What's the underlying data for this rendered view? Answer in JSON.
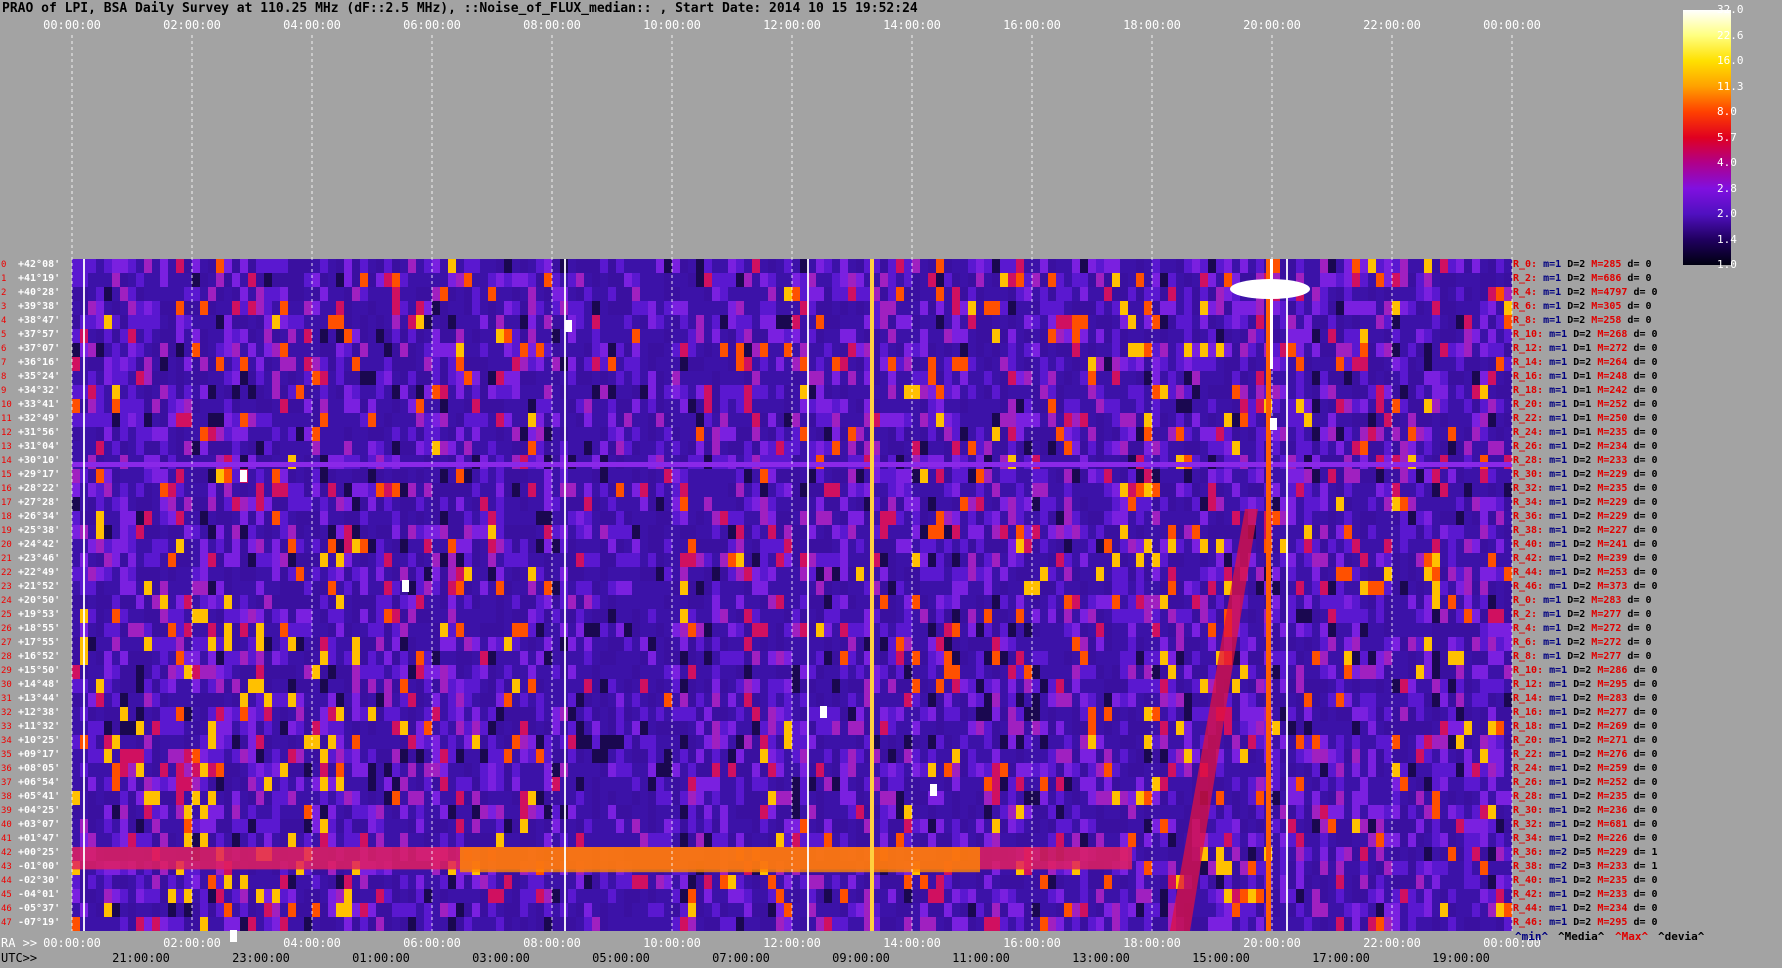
{
  "title": "PRAO of LPI, BSA Daily Survey at 110.25 MHz (dF::2.5 MHz), ::Noise_of_FLUX_median:: , Start Date: 2014 10 15 19:52:24",
  "chart_data": {
    "type": "heatmap",
    "top_ticks": [
      "00:00:00",
      "02:00:00",
      "04:00:00",
      "06:00:00",
      "08:00:00",
      "10:00:00",
      "12:00:00",
      "14:00:00",
      "16:00:00",
      "18:00:00",
      "20:00:00",
      "22:00:00",
      "00:00:00"
    ],
    "ra_axis_label": "RA >>",
    "ra_ticks": [
      "00:00:00",
      "02:00:00",
      "04:00:00",
      "06:00:00",
      "08:00:00",
      "10:00:00",
      "12:00:00",
      "14:00:00",
      "16:00:00",
      "18:00:00",
      "20:00:00",
      "22:00:00",
      "00:00:00"
    ],
    "utc_axis_label": "UTC>>",
    "utc_ticks": [
      "21:00:00",
      "23:00:00",
      "01:00:00",
      "03:00:00",
      "05:00:00",
      "07:00:00",
      "09:00:00",
      "11:00:00",
      "13:00:00",
      "15:00:00",
      "17:00:00",
      "19:00:00"
    ],
    "declinations": [
      "+42°08'",
      "+41°19'",
      "+40°28'",
      "+39°38'",
      "+38°47'",
      "+37°57'",
      "+37°07'",
      "+36°16'",
      "+35°24'",
      "+34°32'",
      "+33°41'",
      "+32°49'",
      "+31°56'",
      "+31°04'",
      "+30°10'",
      "+29°17'",
      "+28°22'",
      "+27°28'",
      "+26°34'",
      "+25°38'",
      "+24°42'",
      "+23°46'",
      "+22°49'",
      "+21°52'",
      "+20°50'",
      "+19°53'",
      "+18°55'",
      "+17°55'",
      "+16°52'",
      "+15°50'",
      "+14°48'",
      "+13°44'",
      "+12°38'",
      "+11°32'",
      "+10°25'",
      "+09°17'",
      "+08°05'",
      "+06°54'",
      "+05°41'",
      "+04°25'",
      "+03°07'",
      "+01°47'",
      "+00°25'",
      "-01°00'",
      "-02°30'",
      "-04°01'",
      "-05°37'",
      "-07°19'"
    ],
    "row_stats": [
      {
        "r": "R_0:",
        "m": "m=1",
        "d": "D=2",
        "x": "M=285",
        "dv": "d= 0"
      },
      {
        "r": "R_2:",
        "m": "m=1",
        "d": "D=2",
        "x": "M=686",
        "dv": "d= 0"
      },
      {
        "r": "R_4:",
        "m": "m=1",
        "d": "D=2",
        "x": "M=4797",
        "dv": "d= 0"
      },
      {
        "r": "R_6:",
        "m": "m=1",
        "d": "D=2",
        "x": "M=305",
        "dv": "d= 0"
      },
      {
        "r": "R_8:",
        "m": "m=1",
        "d": "D=2",
        "x": "M=258",
        "dv": "d= 0"
      },
      {
        "r": "R_10:",
        "m": "m=1",
        "d": "D=2",
        "x": "M=268",
        "dv": "d= 0"
      },
      {
        "r": "R_12:",
        "m": "m=1",
        "d": "D=1",
        "x": "M=272",
        "dv": "d= 0"
      },
      {
        "r": "R_14:",
        "m": "m=1",
        "d": "D=2",
        "x": "M=264",
        "dv": "d= 0"
      },
      {
        "r": "R_16:",
        "m": "m=1",
        "d": "D=1",
        "x": "M=248",
        "dv": "d= 0"
      },
      {
        "r": "R_18:",
        "m": "m=1",
        "d": "D=1",
        "x": "M=242",
        "dv": "d= 0"
      },
      {
        "r": "R_20:",
        "m": "m=1",
        "d": "D=1",
        "x": "M=252",
        "dv": "d= 0"
      },
      {
        "r": "R_22:",
        "m": "m=1",
        "d": "D=1",
        "x": "M=250",
        "dv": "d= 0"
      },
      {
        "r": "R_24:",
        "m": "m=1",
        "d": "D=1",
        "x": "M=235",
        "dv": "d= 0"
      },
      {
        "r": "R_26:",
        "m": "m=1",
        "d": "D=2",
        "x": "M=234",
        "dv": "d= 0"
      },
      {
        "r": "R_28:",
        "m": "m=1",
        "d": "D=2",
        "x": "M=233",
        "dv": "d= 0"
      },
      {
        "r": "R_30:",
        "m": "m=1",
        "d": "D=2",
        "x": "M=229",
        "dv": "d= 0"
      },
      {
        "r": "R_32:",
        "m": "m=1",
        "d": "D=2",
        "x": "M=235",
        "dv": "d= 0"
      },
      {
        "r": "R_34:",
        "m": "m=1",
        "d": "D=2",
        "x": "M=229",
        "dv": "d= 0"
      },
      {
        "r": "R_36:",
        "m": "m=1",
        "d": "D=2",
        "x": "M=229",
        "dv": "d= 0"
      },
      {
        "r": "R_38:",
        "m": "m=1",
        "d": "D=2",
        "x": "M=227",
        "dv": "d= 0"
      },
      {
        "r": "R_40:",
        "m": "m=1",
        "d": "D=2",
        "x": "M=241",
        "dv": "d= 0"
      },
      {
        "r": "R_42:",
        "m": "m=1",
        "d": "D=2",
        "x": "M=239",
        "dv": "d= 0"
      },
      {
        "r": "R_44:",
        "m": "m=1",
        "d": "D=2",
        "x": "M=253",
        "dv": "d= 0"
      },
      {
        "r": "R_46:",
        "m": "m=1",
        "d": "D=2",
        "x": "M=373",
        "dv": "d= 0"
      },
      {
        "r": "R_0:",
        "m": "m=1",
        "d": "D=2",
        "x": "M=283",
        "dv": "d= 0"
      },
      {
        "r": "R_2:",
        "m": "m=1",
        "d": "D=2",
        "x": "M=277",
        "dv": "d= 0"
      },
      {
        "r": "R_4:",
        "m": "m=1",
        "d": "D=2",
        "x": "M=272",
        "dv": "d= 0"
      },
      {
        "r": "R_6:",
        "m": "m=1",
        "d": "D=2",
        "x": "M=272",
        "dv": "d= 0"
      },
      {
        "r": "R_8:",
        "m": "m=1",
        "d": "D=2",
        "x": "M=277",
        "dv": "d= 0"
      },
      {
        "r": "R_10:",
        "m": "m=1",
        "d": "D=2",
        "x": "M=286",
        "dv": "d= 0"
      },
      {
        "r": "R_12:",
        "m": "m=1",
        "d": "D=2",
        "x": "M=295",
        "dv": "d= 0"
      },
      {
        "r": "R_14:",
        "m": "m=1",
        "d": "D=2",
        "x": "M=283",
        "dv": "d= 0"
      },
      {
        "r": "R_16:",
        "m": "m=1",
        "d": "D=2",
        "x": "M=277",
        "dv": "d= 0"
      },
      {
        "r": "R_18:",
        "m": "m=1",
        "d": "D=2",
        "x": "M=269",
        "dv": "d= 0"
      },
      {
        "r": "R_20:",
        "m": "m=1",
        "d": "D=2",
        "x": "M=271",
        "dv": "d= 0"
      },
      {
        "r": "R_22:",
        "m": "m=1",
        "d": "D=2",
        "x": "M=276",
        "dv": "d= 0"
      },
      {
        "r": "R_24:",
        "m": "m=1",
        "d": "D=2",
        "x": "M=259",
        "dv": "d= 0"
      },
      {
        "r": "R_26:",
        "m": "m=1",
        "d": "D=2",
        "x": "M=252",
        "dv": "d= 0"
      },
      {
        "r": "R_28:",
        "m": "m=1",
        "d": "D=2",
        "x": "M=235",
        "dv": "d= 0"
      },
      {
        "r": "R_30:",
        "m": "m=1",
        "d": "D=2",
        "x": "M=236",
        "dv": "d= 0"
      },
      {
        "r": "R_32:",
        "m": "m=1",
        "d": "D=2",
        "x": "M=681",
        "dv": "d= 0"
      },
      {
        "r": "R_34:",
        "m": "m=1",
        "d": "D=2",
        "x": "M=226",
        "dv": "d= 0"
      },
      {
        "r": "R_36:",
        "m": "m=2",
        "d": "D=5",
        "x": "M=229",
        "dv": "d= 1"
      },
      {
        "r": "R_38:",
        "m": "m=2",
        "d": "D=3",
        "x": "M=233",
        "dv": "d= 1"
      },
      {
        "r": "R_40:",
        "m": "m=1",
        "d": "D=2",
        "x": "M=235",
        "dv": "d= 0"
      },
      {
        "r": "R_42:",
        "m": "m=1",
        "d": "D=2",
        "x": "M=233",
        "dv": "d= 0"
      },
      {
        "r": "R_44:",
        "m": "m=1",
        "d": "D=2",
        "x": "M=234",
        "dv": "d= 0"
      },
      {
        "r": "R_46:",
        "m": "m=1",
        "d": "D=2",
        "x": "M=295",
        "dv": "d= 0"
      }
    ],
    "colorbar": {
      "ticks": [
        "32.0",
        "22.6",
        "16.0",
        "11.3",
        "8.0",
        "5.7",
        "4.0",
        "2.8",
        "2.0",
        "1.4",
        "1.0"
      ],
      "colors": [
        "#ffffff",
        "#ffff80",
        "#ffe000",
        "#ffa000",
        "#ff4000",
        "#e00020",
        "#b0008a",
        "#8010e0",
        "#5010c0",
        "#200060",
        "#000010"
      ]
    },
    "footer_keys": [
      {
        "label": "^min^",
        "color": "#000080"
      },
      {
        "label": "^Media^",
        "color": "#000000"
      },
      {
        "label": "^Max^",
        "color": "#e00000"
      },
      {
        "label": "^devia^",
        "color": "#000000"
      }
    ]
  }
}
